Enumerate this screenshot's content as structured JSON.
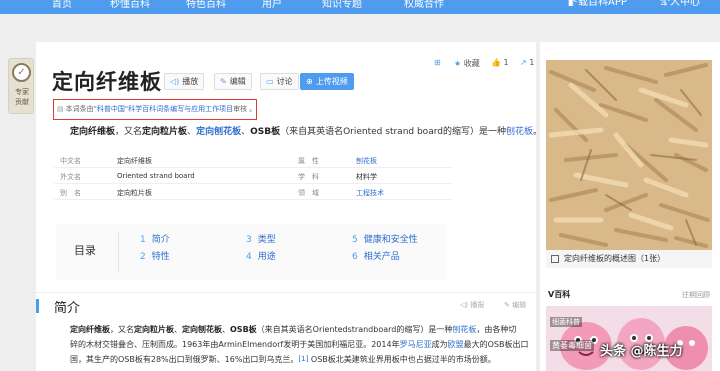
{
  "nav": {
    "items": [
      "首页",
      "秒懂百科",
      "特色百科",
      "用户",
      "知识专题",
      "权威合作"
    ],
    "download": "下载百科APP",
    "personal": "个人中心"
  },
  "sidebar": {
    "expert_label_1": "专家",
    "expert_label_2": "贡献"
  },
  "entry": {
    "title": "定向纤维板",
    "toolbar": {
      "play": "播放",
      "edit": "编辑",
      "discuss": "讨论",
      "upload_video": "上传视频"
    },
    "top_actions": {
      "favorite": "收藏",
      "like_count": "1",
      "share_count": "1"
    },
    "review": {
      "prefix": "本词条由",
      "link": "\"科普中国\"科学百科词条编写与应用工作项目",
      "suffix": "审核 。"
    },
    "summary": {
      "t1": "定向纤维板",
      "t2": "，又名",
      "t3": "定向粒片板",
      "t4": "、",
      "t5": "定向刨花板",
      "t6": "、",
      "t7": "OSB板",
      "t8": "（来自其英语名Oriented strand board的缩写）是一种",
      "t9": "刨花板",
      "t10": "。"
    },
    "basic_info": [
      {
        "k1": "中文名",
        "v1": "定向纤维板",
        "k2": "属　性",
        "v2": "刨花板",
        "v2_link": true
      },
      {
        "k1": "外文名",
        "v1": "Oriented strand board",
        "k2": "学　科",
        "v2": "材料学",
        "v2_link": false
      },
      {
        "k1": "别　名",
        "v1": "定向粒片板",
        "k2": "领　域",
        "v2": "工程技术",
        "v2_link": true
      }
    ],
    "toc": {
      "heading": "目录",
      "items": [
        {
          "num": "1",
          "text": "简介"
        },
        {
          "num": "2",
          "text": "特性"
        },
        {
          "num": "3",
          "text": "类型"
        },
        {
          "num": "4",
          "text": "用途"
        },
        {
          "num": "5",
          "text": "健康和安全性"
        },
        {
          "num": "6",
          "text": "相关产品"
        }
      ]
    },
    "section": {
      "title": "简介",
      "play": "播报",
      "edit": "编辑",
      "line1": {
        "a": "定向纤维板",
        "b": "，又名",
        "c": "定向粒片板",
        "d": "、",
        "e": "定向刨花板",
        "f": "、",
        "g": "OSB板",
        "h": "（来自其英语名Orientedstrandboard的缩写）是一种",
        "i": "刨花板",
        "j": "，由各种切"
      },
      "line2": {
        "a": "碎的木材交错叠合、压制而成。1963年由ArminElmendorf发明于美国加利福尼亚。2014年",
        "b": "罗马尼亚",
        "c": "成为",
        "d": "欧盟",
        "e": "最大的OSB板出口"
      },
      "line3": {
        "a": "国，其生产的OSB板有28%出口到俄罗斯、16%出口到乌克兰。",
        "ref": "[1]",
        "b": " OSB板北美建筑业界用板中也占据过半的市场份额。"
      }
    }
  },
  "right": {
    "photo_caption": "定向纤维板的概述图（1张）",
    "v_title": "V百科",
    "v_more": "往期回顾",
    "v_tag": "细菌科普",
    "v_video_title": "黄萎毒细菌"
  },
  "watermark": "头条 @陈生力",
  "colors": {
    "nav": "#4f9cee",
    "link": "#2e6fd0",
    "review_border": "#e53935"
  }
}
